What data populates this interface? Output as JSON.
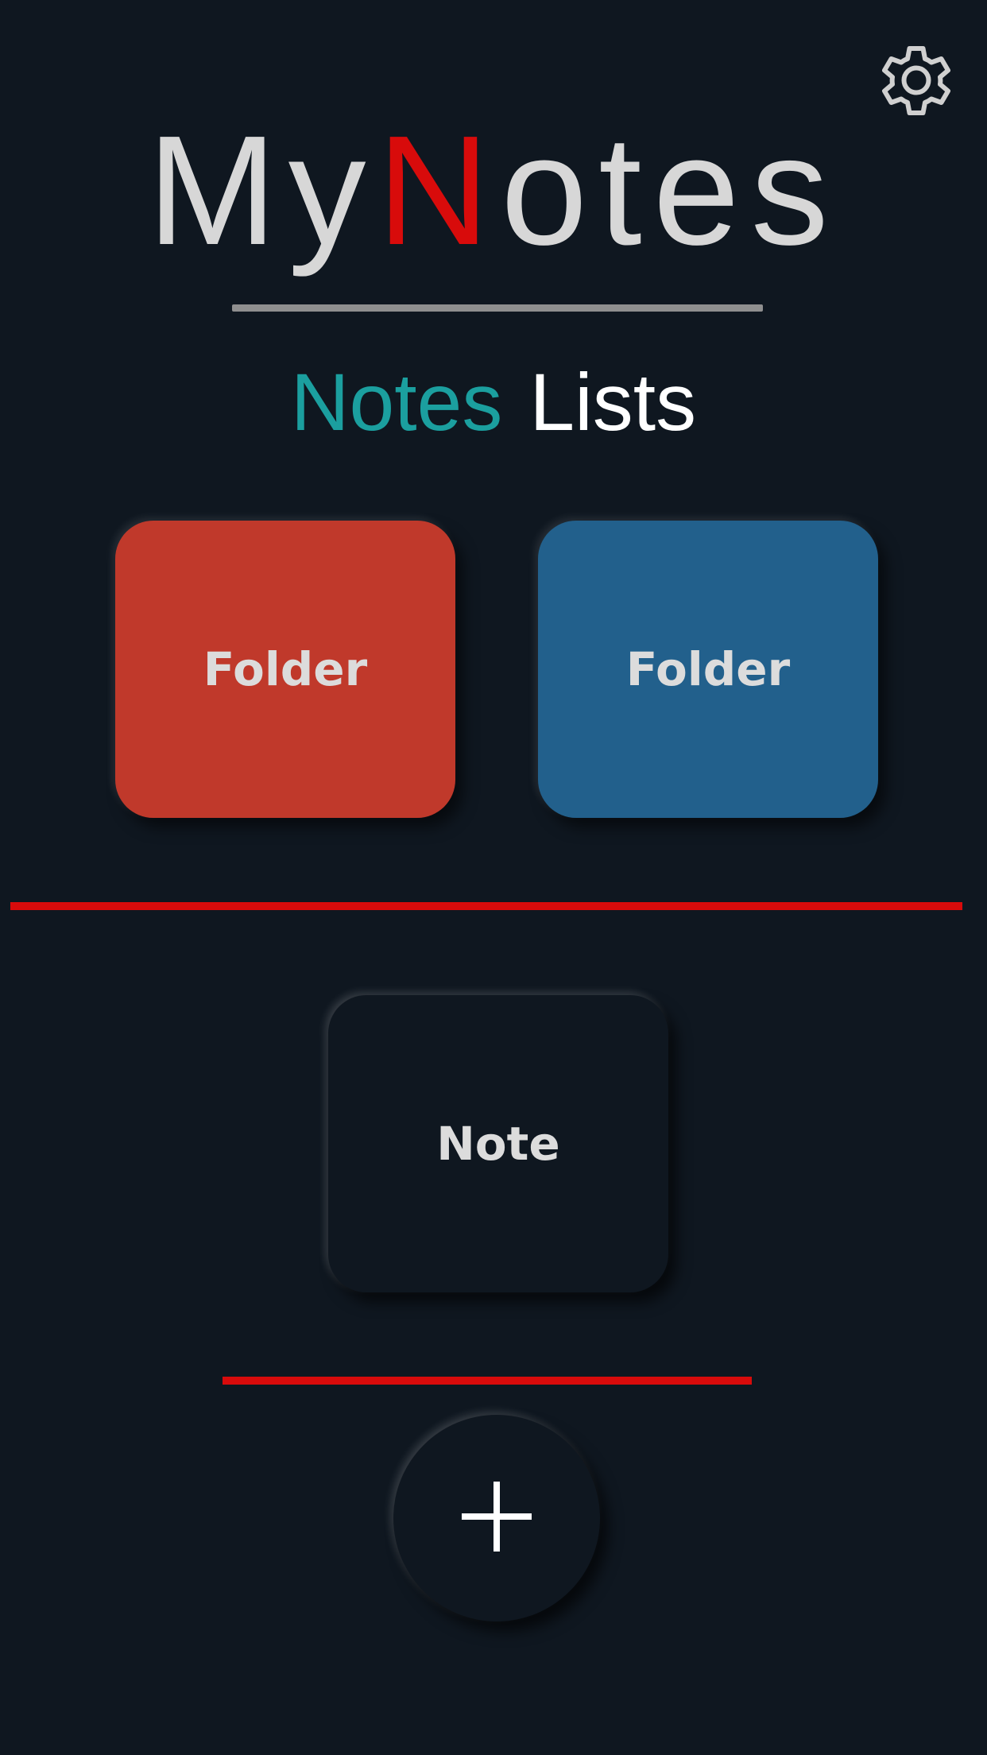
{
  "header": {
    "title_part1": "My",
    "title_accent": "N",
    "title_part2": "otes",
    "settings_icon": "gear-icon"
  },
  "tabs": [
    {
      "label": "Notes",
      "active": true
    },
    {
      "label": "Lists",
      "active": false
    }
  ],
  "folders": [
    {
      "label": "Folder",
      "color": "#c0392b"
    },
    {
      "label": "Folder",
      "color": "#22608c"
    }
  ],
  "notes": [
    {
      "label": "Note"
    }
  ],
  "actions": {
    "add_icon": "plus-icon"
  },
  "colors": {
    "background": "#0f1720",
    "accent_red": "#d80b0b",
    "tab_active": "#1b9f9f",
    "title_text": "#d7d7d7"
  }
}
